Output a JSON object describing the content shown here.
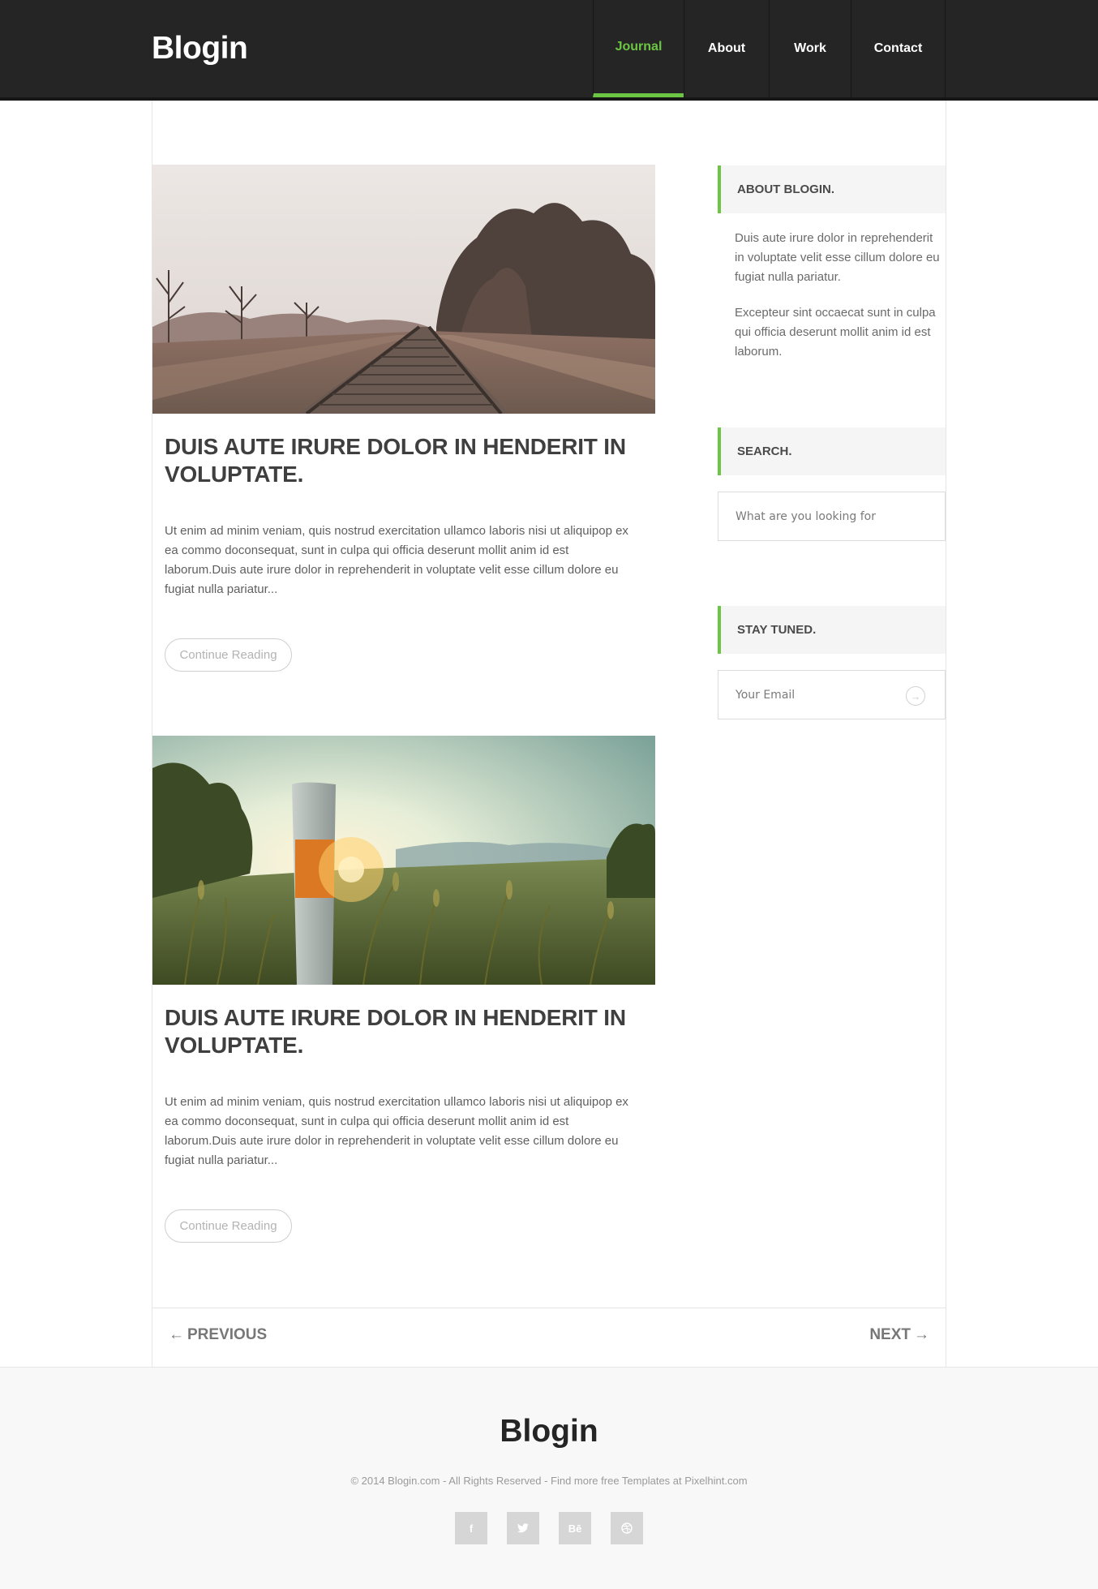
{
  "header": {
    "logo": "Blogin",
    "nav": [
      "Journal",
      "About",
      "Work",
      "Contact"
    ],
    "active_nav": "Journal",
    "accent_color": "#6cc644"
  },
  "posts": [
    {
      "image": "railway-tracks-photo",
      "title": "DUIS AUTE IRURE DOLOR IN HENDERIT IN VOLUPTATE.",
      "excerpt": "Ut enim ad minim veniam, quis nostrud exercitation ullamco laboris nisi ut aliquipop ex ea commo doconsequat, sunt in culpa qui officia deserunt mollit anim id est laborum.Duis aute irure dolor in reprehenderit in voluptate velit esse cillum dolore eu fugiat nulla pariatur...",
      "button": "Continue Reading"
    },
    {
      "image": "sunset-field-photo",
      "title": "DUIS AUTE IRURE DOLOR IN HENDERIT IN VOLUPTATE.",
      "excerpt": "Ut enim ad minim veniam, quis nostrud exercitation ullamco laboris nisi ut aliquipop ex ea commo doconsequat, sunt in culpa qui officia deserunt mollit anim id est laborum.Duis aute irure dolor in reprehenderit in voluptate velit esse cillum dolore eu fugiat nulla pariatur...",
      "button": "Continue Reading"
    }
  ],
  "sidebar": {
    "about": {
      "heading": "ABOUT BLOGIN.",
      "paragraphs": [
        "Duis aute irure dolor in reprehenderit in voluptate velit esse cillum dolore eu fugiat nulla pariatur.",
        "Excepteur sint occaecat sunt in culpa qui officia deserunt mollit anim id est laborum."
      ]
    },
    "search": {
      "heading": "SEARCH.",
      "placeholder": "What are you looking for"
    },
    "newsletter": {
      "heading": "STAY TUNED.",
      "placeholder": "Your Email",
      "submit_icon": "arrow-right-circle-icon"
    }
  },
  "pagination": {
    "previous": "PREVIOUS",
    "next": "NEXT"
  },
  "footer": {
    "logo": "Blogin",
    "copyright": "© 2014 Blogin.com - All Rights Reserved - Find more free Templates at Pixelhint.com",
    "socials": [
      {
        "icon": "facebook-icon",
        "glyph": "f"
      },
      {
        "icon": "twitter-icon",
        "glyph": "🐦"
      },
      {
        "icon": "behance-icon",
        "glyph": "Bē"
      },
      {
        "icon": "dribbble-icon",
        "glyph": "◍"
      }
    ]
  }
}
